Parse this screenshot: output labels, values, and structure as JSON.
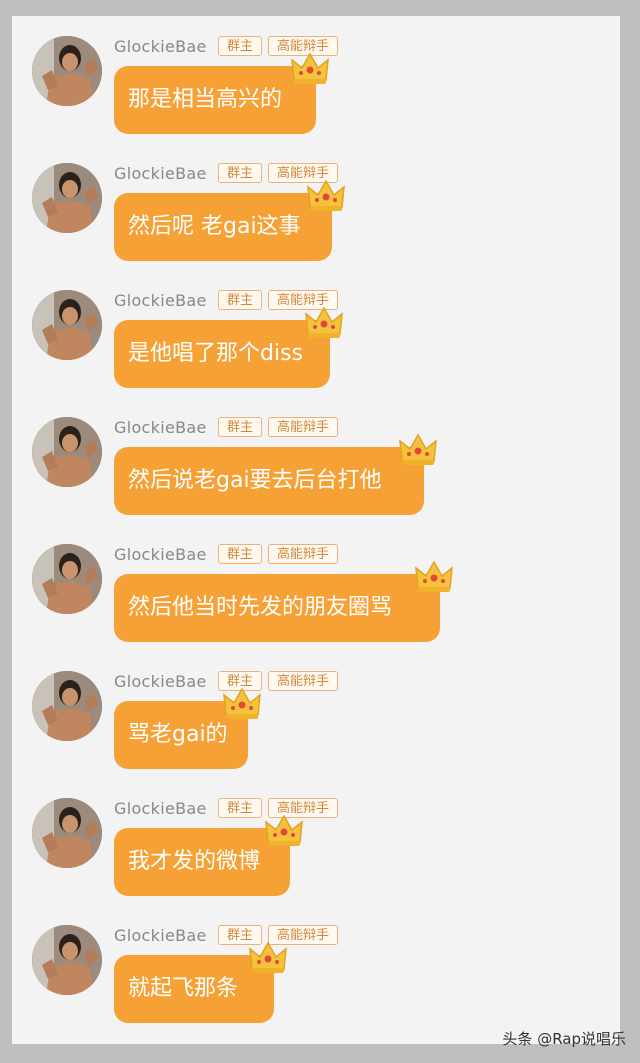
{
  "messages": [
    {
      "user": "GlockieBae",
      "badge_owner": "群主",
      "badge_skill": "高能辩手",
      "text": "那是相当高兴的"
    },
    {
      "user": "GlockieBae",
      "badge_owner": "群主",
      "badge_skill": "高能辩手",
      "text": "然后呢 老gai这事"
    },
    {
      "user": "GlockieBae",
      "badge_owner": "群主",
      "badge_skill": "高能辩手",
      "text": "是他唱了那个diss"
    },
    {
      "user": "GlockieBae",
      "badge_owner": "群主",
      "badge_skill": "高能辩手",
      "text": "然后说老gai要去后台打他"
    },
    {
      "user": "GlockieBae",
      "badge_owner": "群主",
      "badge_skill": "高能辩手",
      "text": "然后他当时先发的朋友圈骂"
    },
    {
      "user": "GlockieBae",
      "badge_owner": "群主",
      "badge_skill": "高能辩手",
      "text": "骂老gai的"
    },
    {
      "user": "GlockieBae",
      "badge_owner": "群主",
      "badge_skill": "高能辩手",
      "text": "我才发的微博"
    },
    {
      "user": "GlockieBae",
      "badge_owner": "群主",
      "badge_skill": "高能辩手",
      "text": "就起飞那条"
    }
  ],
  "watermark": "头条 @Rap说唱乐",
  "colors": {
    "bubble": "#f6a136",
    "badge_text": "#d08a3a",
    "username": "#888888"
  },
  "icons": {
    "crown": "crown-icon",
    "avatar": "avatar"
  }
}
